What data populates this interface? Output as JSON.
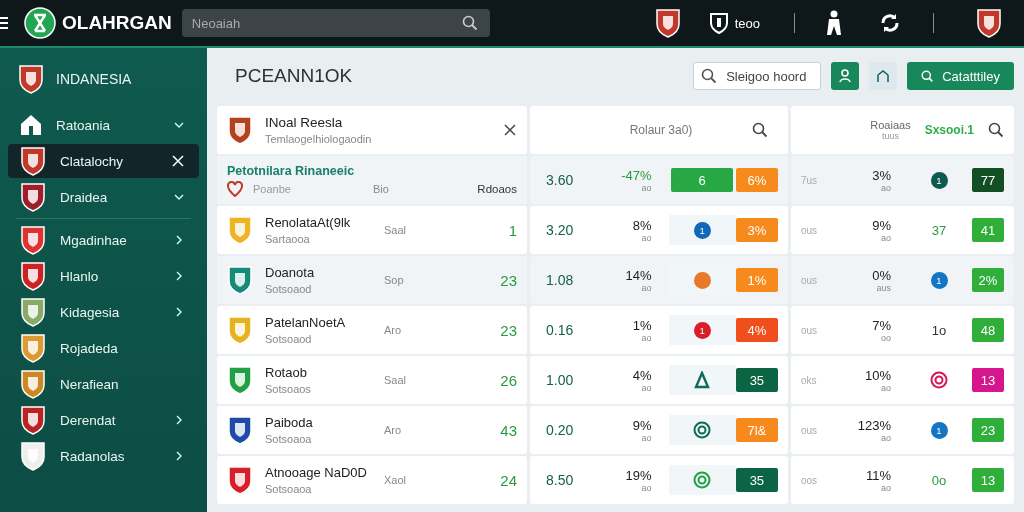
{
  "app": {
    "title": "OLAHRGAN",
    "search_placeholder": "Neoaiah",
    "user_label": "teoo"
  },
  "sidebar": {
    "title": "INDANESIA",
    "items": [
      {
        "label": "Ratoania",
        "selected": false,
        "expandable": true,
        "closable": false
      },
      {
        "label": "Clatalochy",
        "selected": true,
        "expandable": false,
        "closable": true
      },
      {
        "label": "Draidea",
        "selected": false,
        "expandable": true,
        "closable": false
      },
      {
        "label": "Mgadinhae",
        "selected": false,
        "expandable": true,
        "closable": false
      },
      {
        "label": "Hlanlo",
        "selected": false,
        "expandable": true,
        "closable": false
      },
      {
        "label": "Kidagesia",
        "selected": false,
        "expandable": true,
        "closable": false
      },
      {
        "label": "Rojadeda",
        "selected": false,
        "expandable": false,
        "closable": false
      },
      {
        "label": "Nerafiean",
        "selected": false,
        "expandable": false,
        "closable": false
      },
      {
        "label": "Derendat",
        "selected": false,
        "expandable": true,
        "closable": false
      },
      {
        "label": "Radanolas",
        "selected": false,
        "expandable": true,
        "closable": false
      }
    ]
  },
  "toolbar": {
    "title": "PCEANN1OK",
    "search_placeholder": "Sleigoo hoord",
    "button": "Catatttiley"
  },
  "league": {
    "name": "INoal Reesla",
    "subtitle": "Temlaogelhiologaodin"
  },
  "columns": {
    "middle": "Rolaur 3a0)",
    "right": "Roaiaas",
    "right_sub": "tuus",
    "right_accent": "Sxsooi.1"
  },
  "rows": [
    {
      "section_header": true,
      "name": "Petotnilara Rinaneeic",
      "sub": "Poanbe",
      "col3": "Bio",
      "value": "Rdoaos",
      "color": "#c0392b",
      "shaded": true,
      "odds": "3.60",
      "pct": "-47%",
      "pct_sub": "ao",
      "marker": {
        "kind": "badge",
        "text": "6",
        "color": "#27a844"
      },
      "badge": {
        "text": "6%",
        "color": "#f78a1d"
      },
      "mute": "7us",
      "pct2": "3%",
      "pct2_sub": "ao",
      "marker2": {
        "kind": "dot",
        "text": "1",
        "color": "#0e5a4e"
      },
      "badge2": {
        "text": "77",
        "color": "#124f24"
      }
    },
    {
      "section_header": false,
      "name": "RenolataAt(9lk",
      "sub": "Sartaooa",
      "col3": "Saal",
      "value": "1",
      "color": "#f0b323",
      "shaded": false,
      "odds": "3.20",
      "pct": "8%",
      "pct_sub": "ao",
      "marker": {
        "kind": "dot",
        "text": "1",
        "color": "#1167b8"
      },
      "badge": {
        "text": "3%",
        "color": "#f78a1d"
      },
      "mute": "ous",
      "pct2": "9%",
      "pct2_sub": "ao",
      "marker2": {
        "kind": "text",
        "text": "37",
        "color": "#2e9a3e"
      },
      "badge2": {
        "text": "41",
        "color": "#2fae3a"
      }
    },
    {
      "section_header": false,
      "name": "Doanota",
      "sub": "Sotsoaod",
      "col3": "Sop",
      "value": "23",
      "color": "#138a7a",
      "shaded": true,
      "odds": "1.08",
      "pct": "14%",
      "pct_sub": "ao",
      "marker": {
        "kind": "dot",
        "color": "#e8792a"
      },
      "badge": {
        "text": "1%",
        "color": "#f78a1d"
      },
      "mute": "ous",
      "pct2": "0%",
      "pct2_sub": "aus",
      "marker2": {
        "kind": "dot",
        "text": "1",
        "color": "#1475c4"
      },
      "badge2": {
        "text": "2%",
        "color": "#2fae3a"
      }
    },
    {
      "section_header": false,
      "name": "PatelanNoetA",
      "sub": "Sotsoaod",
      "col3": "Aro",
      "value": "23",
      "color": "#e8b21e",
      "shaded": false,
      "odds": "0.16",
      "pct": "1%",
      "pct_sub": "ao",
      "marker": {
        "kind": "dot",
        "text": "1",
        "color": "#d81e28"
      },
      "badge": {
        "text": "4%",
        "color": "#f04e1c"
      },
      "mute": "ous",
      "pct2": "7%",
      "pct2_sub": "oo",
      "marker2": {
        "kind": "text",
        "text": "1o",
        "color": "#333333"
      },
      "badge2": {
        "text": "48",
        "color": "#2fae3a"
      }
    },
    {
      "section_header": false,
      "name": "Rotaob",
      "sub": "Sotsoaos",
      "col3": "Saal",
      "value": "26",
      "color": "#22a045",
      "shaded": false,
      "odds": "1.00",
      "pct": "4%",
      "pct_sub": "ao",
      "marker": {
        "kind": "triangle",
        "color": "#0e6b5a"
      },
      "badge": {
        "text": "35",
        "color": "#0b6443"
      },
      "mute": "oks",
      "pct2": "10%",
      "pct2_sub": "ao",
      "marker2": {
        "kind": "ring",
        "color": "#d6165a"
      },
      "badge2": {
        "text": "13",
        "color": "#d6168c"
      }
    },
    {
      "section_header": false,
      "name": "Paiboda",
      "sub": "Sotsoaoa",
      "col3": "Aro",
      "value": "43",
      "color": "#1f4aa8",
      "shaded": false,
      "odds": "0.20",
      "pct": "9%",
      "pct_sub": "ao",
      "marker": {
        "kind": "ring",
        "color": "#0e6b5a"
      },
      "badge": {
        "text": "7l&",
        "color": "#f78a1d"
      },
      "mute": "ous",
      "pct2": "123%",
      "pct2_sub": "ao",
      "marker2": {
        "kind": "dot",
        "text": "1",
        "color": "#1475c4"
      },
      "badge2": {
        "text": "23",
        "color": "#2fae3a"
      }
    },
    {
      "section_header": false,
      "name": "Atnooage NaD0D",
      "sub": "Sotsoaoa",
      "col3": "Xaol",
      "value": "24",
      "color": "#d81e28",
      "shaded": false,
      "odds": "8.50",
      "pct": "19%",
      "pct_sub": "ao",
      "marker": {
        "kind": "ring",
        "color": "#22a045"
      },
      "badge": {
        "text": "35",
        "color": "#0b6443"
      },
      "mute": "oos",
      "pct2": "11%",
      "pct2_sub": "ao",
      "marker2": {
        "kind": "text",
        "text": "0o",
        "color": "#2e9a3e"
      },
      "badge2": {
        "text": "13",
        "color": "#2fae3a"
      }
    }
  ]
}
